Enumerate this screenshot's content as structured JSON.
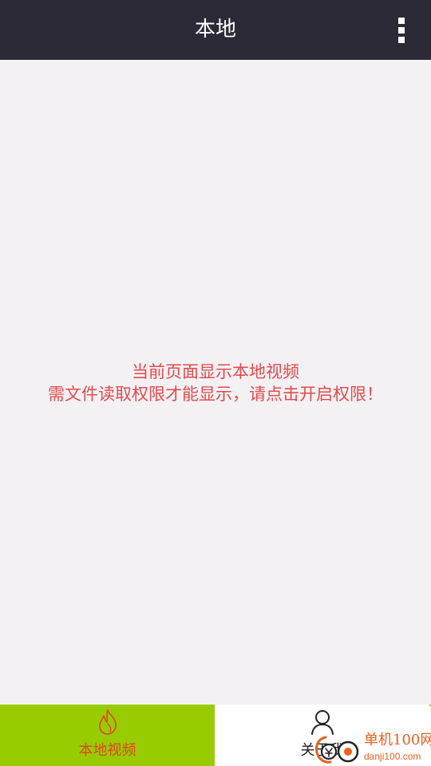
{
  "app_bar": {
    "title": "本地",
    "overflow_icon": "more-vert-icon"
  },
  "notice": {
    "line1": "当前页面显示本地视频",
    "line2": "需文件读取权限才能显示，请点击开启权限！",
    "color": "#e24b4b"
  },
  "bottom_nav": {
    "tabs": [
      {
        "label": "本地视频",
        "icon": "flame-icon",
        "active": true
      },
      {
        "label": "关于我",
        "icon": "person-icon",
        "active": false
      }
    ],
    "active_color": "#99cc00",
    "active_label_color": "#e2431d"
  },
  "watermark": {
    "name": "单机100网",
    "url": "danji100.com"
  }
}
